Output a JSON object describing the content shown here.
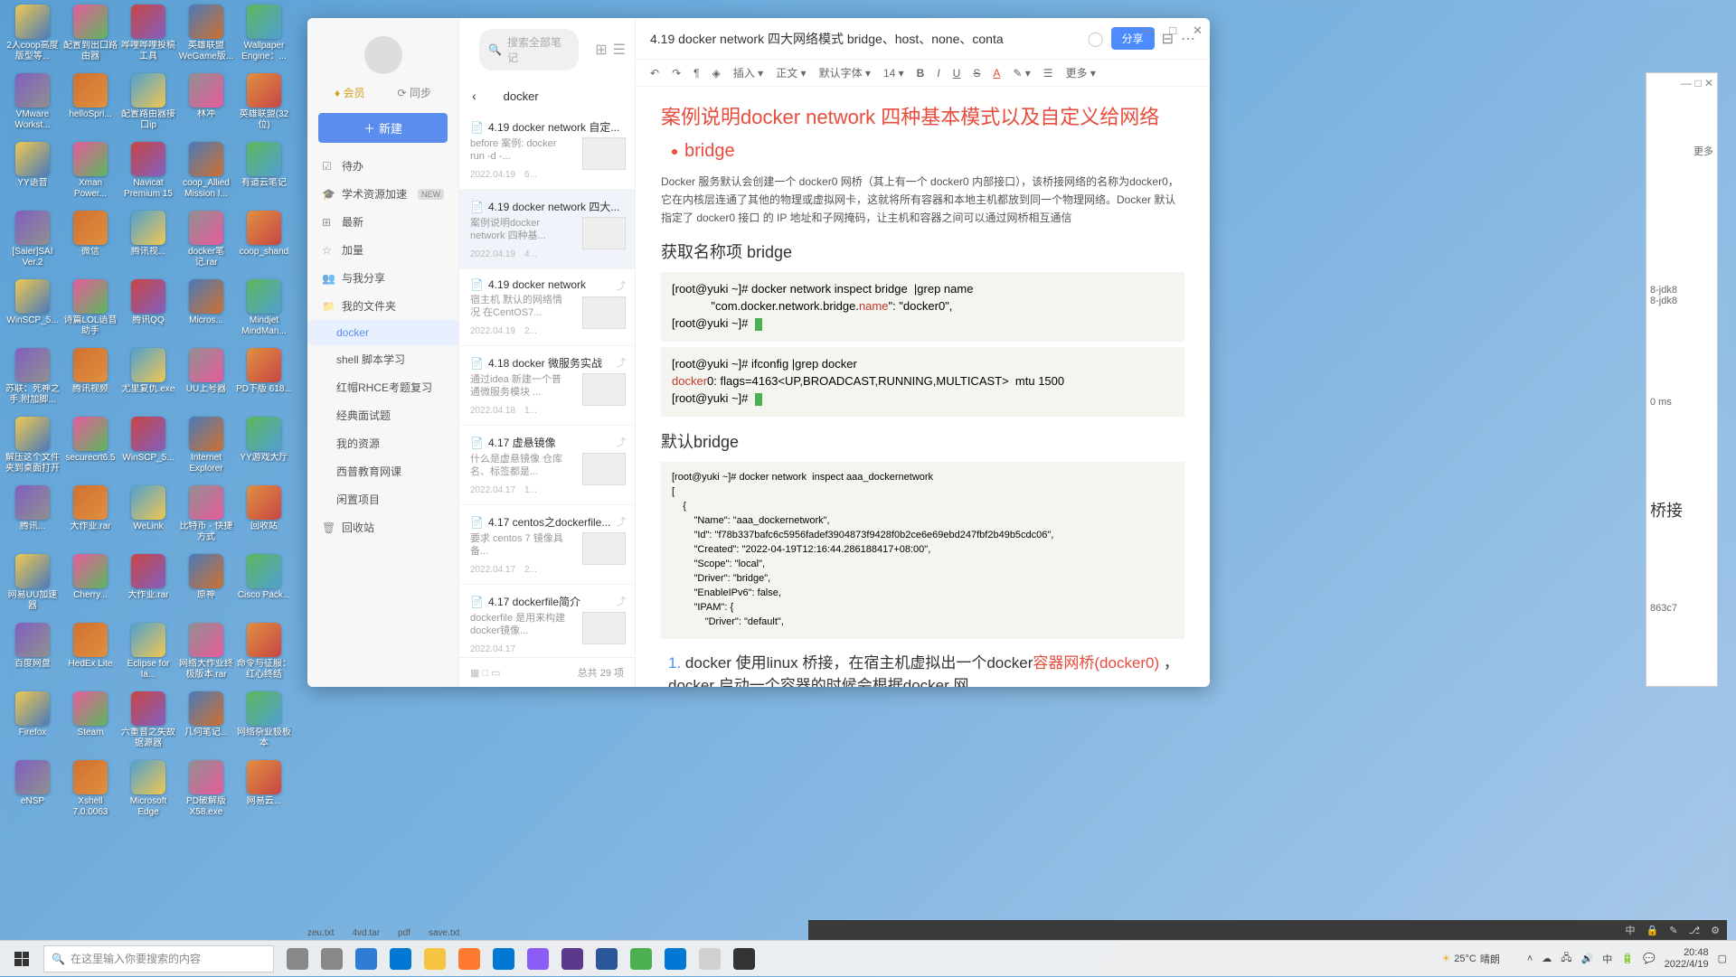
{
  "desktop_icons": [
    "2人coop高度版型等...",
    "配置到出口路由器",
    "哗哩哗哩投稿工具",
    "英雄联盟WeGame版...",
    "Wallpaper Engine：...",
    "VMware Workst...",
    "helloSpri...",
    "配置路由器接口ip",
    "林冲",
    "英雄联盟(32位)",
    "YY语音",
    "Xman Power...",
    "Navicat Premium 15",
    "coop_Allied Mission I...",
    "有道云笔记",
    "[Saier]SAI Ver.2",
    "微信",
    "腾讯视...",
    "docker笔记.rar",
    "coop_shand",
    "WinSCP_5...",
    "诗篇LOL语音助手",
    "腾讯QQ",
    "Micros...",
    "Mindjet MindMan...",
    "苏联：死神之手.附加脚...",
    "腾讯视频",
    "尤里复仇.exe",
    "UU上号器",
    "PD下版 618...",
    "解压这个文件夹到桌面打开",
    "securecrt6.5",
    "WinSCP_5...",
    "Internet Explorer",
    "YY游戏大厅",
    "腾讯...",
    "大作业.rar",
    "WeLink",
    "比特币 - 快捷方式",
    "回收站",
    "网易UU加速器",
    "Cherry...",
    "大作业.rar",
    "原神",
    "Cisco Pack...",
    "百度网盘",
    "HedEx Lite",
    "Eclipse for Ia...",
    "网络大作业终极版本.rar",
    "命令与征服：红心终结",
    "Firefox",
    "Steam",
    "六重音之失故据源器",
    "几何笔记...",
    "网络杂业极板本",
    "eNSP",
    "Xshell 7.0.0063",
    "Microsoft Edge",
    "PD破解版 X58.exe",
    "网易云..."
  ],
  "note_app": {
    "member": "会员",
    "sync": "同步",
    "new_btn": "新建",
    "nav": {
      "todo": "待办",
      "resource": "学术资源加速",
      "recent": "最新",
      "boost": "加量",
      "share": "与我分享",
      "myfolder": "我的文件夹",
      "docker": "docker",
      "shell": "shell 脚本学习",
      "rhce": "红帽RHCE考题复习",
      "interview": "经典面试题",
      "myres": "我的资源",
      "edu": "西普教育网课",
      "closed": "闲置项目",
      "trash": "回收站",
      "newtag": "NEW"
    },
    "search_placeholder": "搜索全部笔记",
    "list_title": "docker",
    "notes": [
      {
        "title": "4.19 docker network 自定...",
        "desc": "before 案例: docker run -d -...",
        "date": "2022.04.19",
        "ext": "6..."
      },
      {
        "title": "4.19 docker network 四大...",
        "desc": "案例说明docker network 四种基...",
        "date": "2022.04.19",
        "ext": "4..."
      },
      {
        "title": "4.19 docker network",
        "desc": "宿主机 默认的网络情况 在CentOS7...",
        "date": "2022.04.19",
        "ext": "2..."
      },
      {
        "title": "4.18 docker 微服务实战",
        "desc": "通过idea 新建一个普通微服务模块 ...",
        "date": "2022.04.18",
        "ext": "1..."
      },
      {
        "title": "4.17 虚悬镜像",
        "desc": "什么是虚悬镜像 仓库名、标签都是...",
        "date": "2022.04.17",
        "ext": "1..."
      },
      {
        "title": "4.17 centos之dockerfile...",
        "desc": "要求 centos 7 镜像具备...",
        "date": "2022.04.17",
        "ext": "2..."
      },
      {
        "title": "4.17 dockerfile简介",
        "desc": "dockerfile 是用来构建docker镜像...",
        "date": "2022.04.17",
        "ext": ""
      }
    ],
    "total": "总共 29 项",
    "doc_title": "4.19 docker network  四大网络模式 bridge、host、none、conta",
    "share_btn": "分享",
    "toolbar": {
      "undo": "↶",
      "redo": "↷",
      "h": "¶",
      "erase": "◈",
      "insert": "插入",
      "body": "正文",
      "font": "默认字体",
      "size": "14",
      "more": "更多"
    },
    "content": {
      "h1": "案例说明docker network 四种基本模式以及自定义给网络",
      "bullet": "bridge",
      "para1": "Docker 服务默认会创建一个 docker0 网桥（其上有一个 docker0 内部接口），该桥接网络的名称为docker0，它在内核层连通了其他的物理或虚拟网卡，这就将所有容器和本地主机都放到同一个物理网络。Docker 默认指定了 docker0 接口 的 IP 地址和子网掩码，让主机和容器之间可以通过网桥相互通信",
      "h2a": "获取名称项 bridge",
      "code1_l1": "[root@yuki ~]# docker network inspect bridge  |grep name",
      "code1_l2": "            \"com.docker.network.bridge.",
      "code1_name": "name",
      "code1_l2b": "\": \"docker0\",",
      "code1_l3": "[root@yuki ~]#",
      "code2_l1": "[root@yuki ~]# ifconfig |grep docker",
      "code2_l2a": "docker",
      "code2_l2b": "0: flags=4163<UP,BROADCAST,RUNNING,MULTICAST>  mtu 1500",
      "code2_l3": "[root@yuki ~]#",
      "h2b": "默认bridge",
      "code3": "[root@yuki ~]# docker network  inspect aaa_dockernetwork\n[\n    {\n        \"Name\": \"aaa_dockernetwork\",\n        \"Id\": \"f78b337bafc6c5956fadef3904873f9428f0b2ce6e69ebd247fbf2b49b5cdc06\",\n        \"Created\": \"2022-04-19T12:16:44.286188417+08:00\",\n        \"Scope\": \"local\",\n        \"Driver\": \"bridge\",\n        \"EnableIPv6\": false,\n        \"IPAM\": {\n            \"Driver\": \"default\",",
      "ol1_pre": "docker 使用linux 桥接，在宿主机虚拟出一个docker",
      "ol1_red1": "容器网桥(docker0)",
      "ol1_mid": "  ，docker 启动一个容器的时候会根据docker 网"
    }
  },
  "bg_snippets": [
    "8-jdk8",
    "8-jdk8",
    "0 ms",
    "桥接",
    "863c7",
    "更多"
  ],
  "file_row": [
    "zeu.txt",
    "4vd.tar",
    "pdf",
    "save.txt"
  ],
  "taskbar": {
    "search": "在这里输入你要搜索的内容",
    "weather_temp": "25°C",
    "weather_cond": "晴朗",
    "time": "20:48",
    "date": "2022/4/19"
  }
}
